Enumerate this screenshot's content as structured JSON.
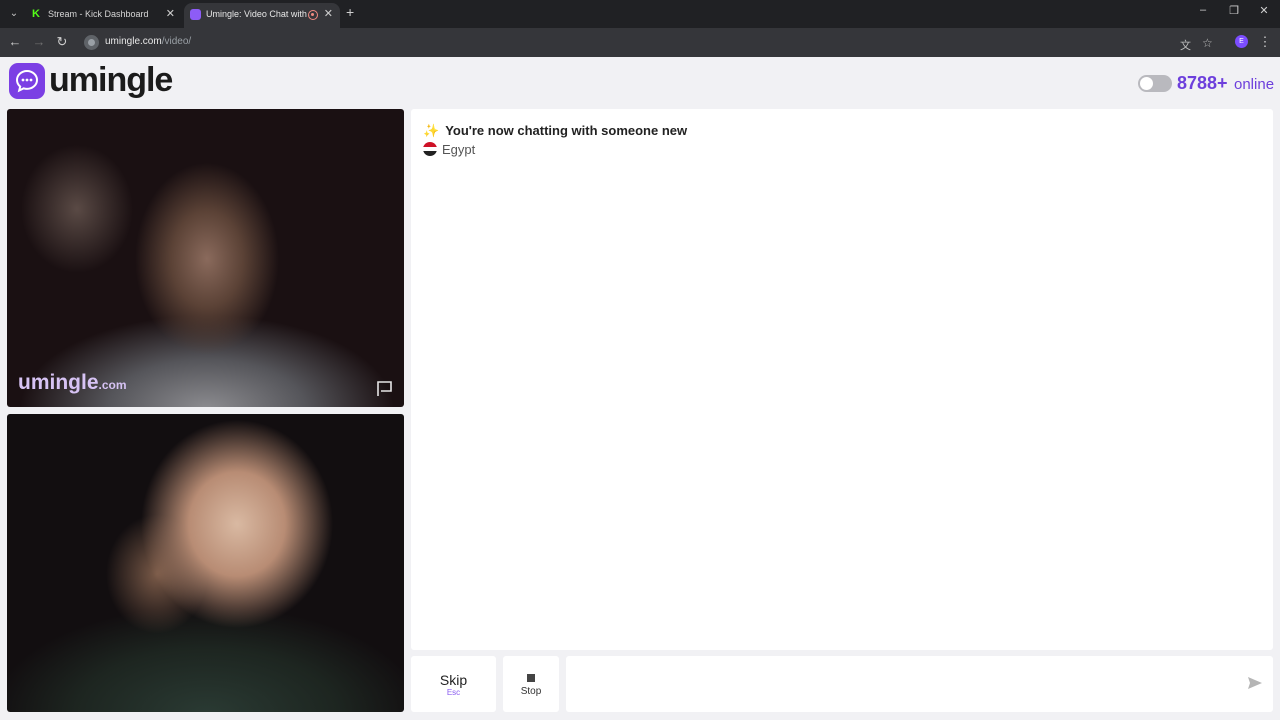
{
  "browser": {
    "tabs": [
      {
        "label": "Stream - Kick Dashboard",
        "favicon": "kick-icon",
        "active": false
      },
      {
        "label": "Umingle: Video Chat with St",
        "favicon": "umingle-icon",
        "active": true
      }
    ],
    "new_tab": "+",
    "url": {
      "host": "umingle.com",
      "path": "/video/"
    },
    "profile_initial": "E",
    "window_controls": {
      "minimize": "–",
      "restore": "❐",
      "close": "✕"
    }
  },
  "header": {
    "brand_name": "umingle",
    "online_count": "8788+",
    "online_word": "online",
    "accent_color": "#6d3fdc"
  },
  "videos": {
    "watermark_main": "umingle",
    "watermark_suffix": ".com"
  },
  "chat": {
    "system_message": "You're now chatting with someone new",
    "country": "Egypt",
    "message_input_value": ""
  },
  "controls": {
    "skip_label": "Skip",
    "skip_hint": "Esc",
    "stop_label": "Stop"
  }
}
